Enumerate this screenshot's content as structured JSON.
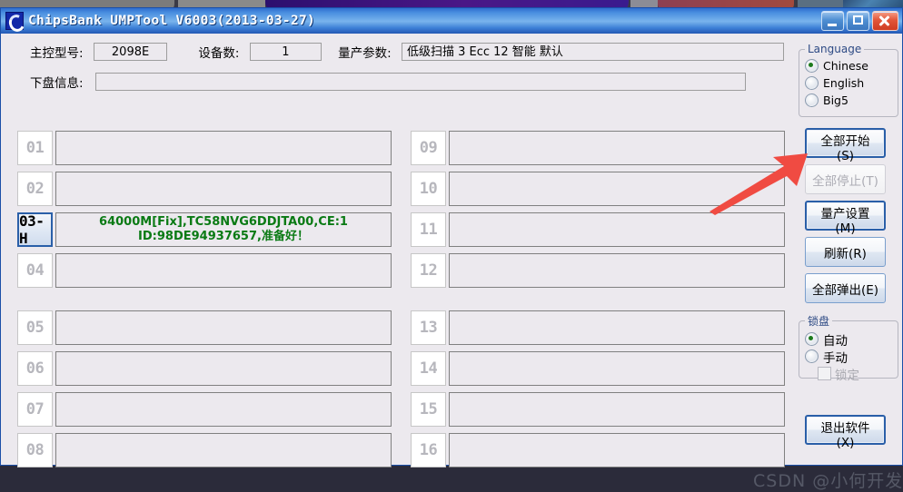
{
  "window": {
    "title": "ChipsBank UMPTool V6003(2013-03-27)",
    "icon": "chipsbank-logo-icon",
    "minimize_label": "Minimize",
    "maximize_label": "Maximize",
    "close_label": "Close"
  },
  "form": {
    "controller_label": "主控型号:",
    "controller_value": "2098E",
    "device_count_label": "设备数:",
    "device_count_value": "1",
    "params_label": "量产参数:",
    "params_value": "低级扫描 3 Ecc 12 智能 默认",
    "disk_info_label": "下盘信息:",
    "disk_info_value": ""
  },
  "slots": {
    "left": [
      {
        "num": "01",
        "active": false,
        "line1": "",
        "line2": ""
      },
      {
        "num": "02",
        "active": false,
        "line1": "",
        "line2": ""
      },
      {
        "num": "03-H",
        "active": true,
        "line1": "64000M[Fix],TC58NVG6DDJTA00,CE:1",
        "line2": "ID:98DE94937657,准备好！"
      },
      {
        "num": "04",
        "active": false,
        "line1": "",
        "line2": ""
      },
      {
        "num": "05",
        "active": false,
        "line1": "",
        "line2": ""
      },
      {
        "num": "06",
        "active": false,
        "line1": "",
        "line2": ""
      },
      {
        "num": "07",
        "active": false,
        "line1": "",
        "line2": ""
      },
      {
        "num": "08",
        "active": false,
        "line1": "",
        "line2": ""
      }
    ],
    "right": [
      {
        "num": "09",
        "active": false,
        "line1": "",
        "line2": ""
      },
      {
        "num": "10",
        "active": false,
        "line1": "",
        "line2": ""
      },
      {
        "num": "11",
        "active": false,
        "line1": "",
        "line2": ""
      },
      {
        "num": "12",
        "active": false,
        "line1": "",
        "line2": ""
      },
      {
        "num": "13",
        "active": false,
        "line1": "",
        "line2": ""
      },
      {
        "num": "14",
        "active": false,
        "line1": "",
        "line2": ""
      },
      {
        "num": "15",
        "active": false,
        "line1": "",
        "line2": ""
      },
      {
        "num": "16",
        "active": false,
        "line1": "",
        "line2": ""
      }
    ]
  },
  "language_group": {
    "legend": "Language",
    "options": [
      {
        "label": "Chinese",
        "selected": true
      },
      {
        "label": "English",
        "selected": false
      },
      {
        "label": "Big5",
        "selected": false
      }
    ]
  },
  "lock_group": {
    "legend": "锁盘",
    "options": [
      {
        "label": "自动",
        "selected": true
      },
      {
        "label": "手动",
        "selected": false
      }
    ],
    "checkbox_label": "锁定",
    "checkbox_checked": false,
    "checkbox_disabled": true
  },
  "buttons": {
    "start_all": "全部开始(S)",
    "stop_all": "全部停止(T)",
    "settings": "量产设置(M)",
    "refresh": "刷新(R)",
    "eject_all": "全部弹出(E)",
    "exit": "退出软件(X)"
  },
  "annotation": {
    "arrow_color": "#f04b42",
    "arrow_target": "start_all"
  },
  "watermark": {
    "text": "CSDN @小何开发"
  },
  "colors": {
    "title_bar_blue": "#4a8fe0",
    "status_green": "#0a7a14",
    "accent_border": "#2a5fa8",
    "client_bg": "#ece9ee",
    "close_red": "#e2563a"
  }
}
